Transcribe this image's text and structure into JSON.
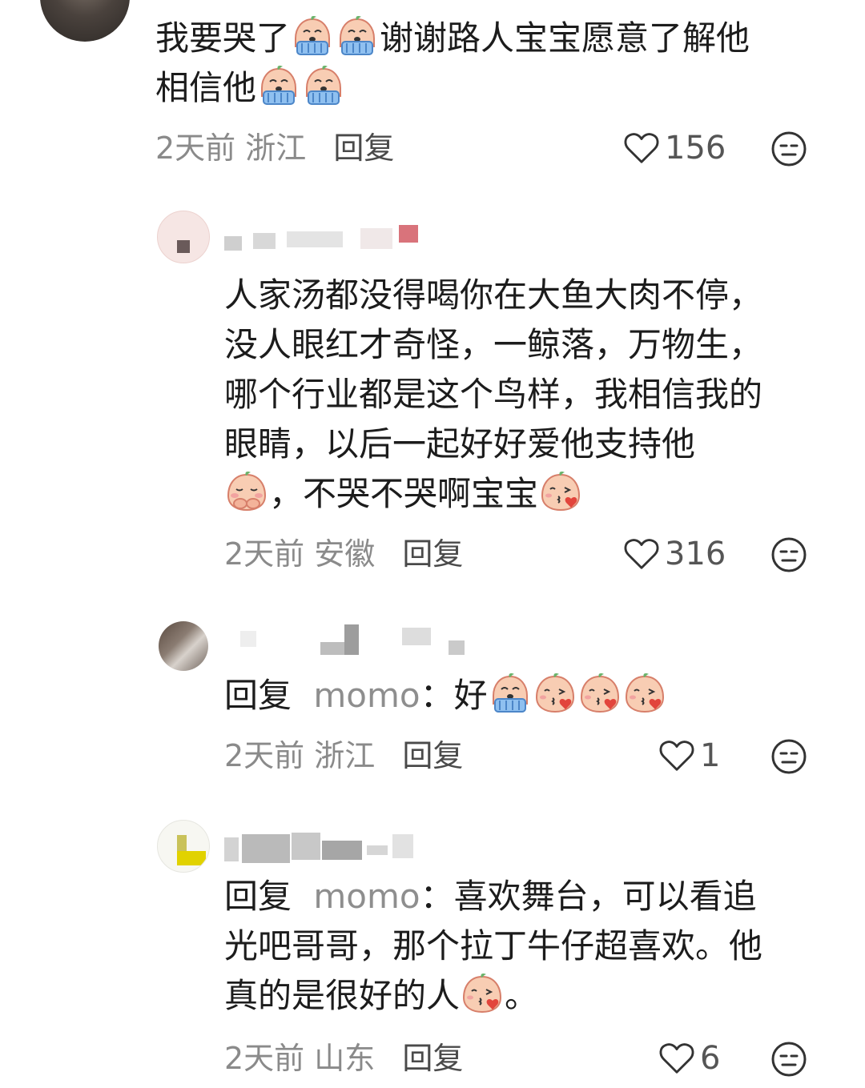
{
  "comments": [
    {
      "text_a": "我要哭了",
      "text_b": "谢谢路人宝宝愿意了解他",
      "text_c": "相信他",
      "time": "2天前",
      "location": "浙江",
      "reply_label": "回复",
      "likes": "156"
    },
    {
      "line1": "人家汤都没得喝你在大鱼大肉不停，",
      "line2": "没人眼红才奇怪，一鲸落，万物生，",
      "line3": "哪个行业都是这个鸟样，我相信我的",
      "line4": "眼睛，以后一起好好爱他支持他",
      "line5": "，不哭不哭啊宝宝",
      "time": "2天前",
      "location": "安徽",
      "reply_label": "回复",
      "likes": "316"
    },
    {
      "prefix": "回复",
      "mention": "momo",
      "colon": "：",
      "text": "好",
      "time": "2天前",
      "location": "浙江",
      "reply_label": "回复",
      "likes": "1"
    },
    {
      "prefix": "回复",
      "mention": "momo",
      "colon": "：",
      "line1": "喜欢舞台，可以看追",
      "line2": "光吧哥哥，那个拉丁牛仔超喜欢。他",
      "line3": "真的是很好的人",
      "end": "。",
      "time": "2天前",
      "location": "山东",
      "reply_label": "回复",
      "likes": "6"
    }
  ],
  "icons": {
    "like": "heart-outline-icon",
    "dislike": "meh-face-icon",
    "cry": "crying-peach-emoji",
    "kiss": "kiss-peach-emoji",
    "shy": "shy-peach-emoji"
  },
  "colors": {
    "text": "#1c1c1c",
    "meta": "#8a8a8a",
    "mention": "#8e8e8e",
    "emoji_body": "#f7c4a8",
    "emoji_tear": "#7fb0e8"
  }
}
